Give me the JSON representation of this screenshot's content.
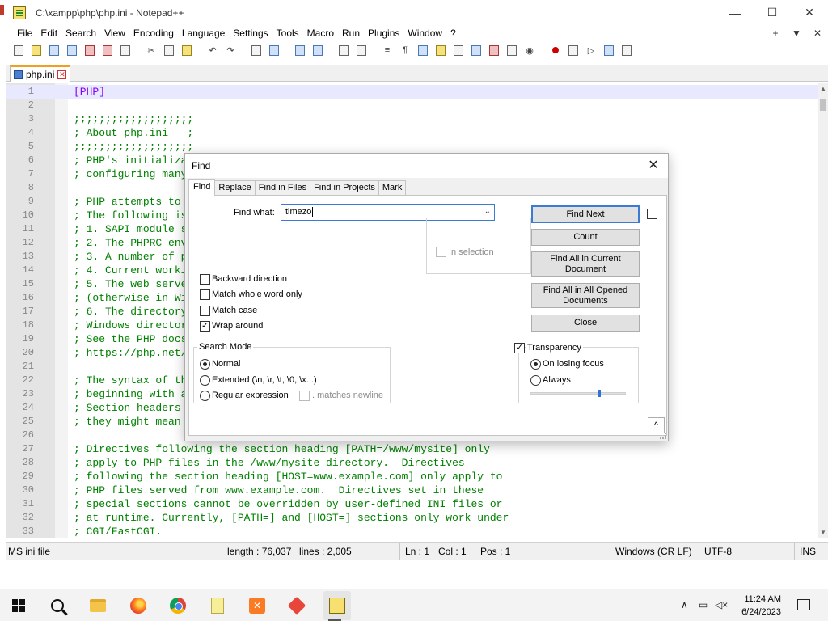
{
  "window": {
    "title": "C:\\xampp\\php\\php.ini - Notepad++",
    "minimize": "—",
    "maximize": "☐",
    "close": "✕"
  },
  "menu": {
    "items": [
      "File",
      "Edit",
      "Search",
      "View",
      "Encoding",
      "Language",
      "Settings",
      "Tools",
      "Macro",
      "Run",
      "Plugins",
      "Window",
      "?"
    ],
    "right": [
      "+",
      "▼",
      "✕"
    ]
  },
  "tab": {
    "label": "php.ini"
  },
  "editor": {
    "lines": [
      {
        "n": "1",
        "text": "[PHP]"
      },
      {
        "n": "2",
        "text": ""
      },
      {
        "n": "3",
        "text": ";;;;;;;;;;;;;;;;;;;"
      },
      {
        "n": "4",
        "text": "; About php.ini   ;"
      },
      {
        "n": "5",
        "text": ";;;;;;;;;;;;;;;;;;;"
      },
      {
        "n": "6",
        "text": "; PHP's initializa"
      },
      {
        "n": "7",
        "text": "; configuring many"
      },
      {
        "n": "8",
        "text": ""
      },
      {
        "n": "9",
        "text": "; PHP attempts to"
      },
      {
        "n": "10",
        "text": "; The following is"
      },
      {
        "n": "11",
        "text": "; 1. SAPI module s"
      },
      {
        "n": "12",
        "text": "; 2. The PHPRC env"
      },
      {
        "n": "13",
        "text": "; 3. A number of p"
      },
      {
        "n": "14",
        "text": "; 4. Current worki"
      },
      {
        "n": "15",
        "text": "; 5. The web serve"
      },
      {
        "n": "16",
        "text": "; (otherwise in Wi"
      },
      {
        "n": "17",
        "text": "; 6. The directory"
      },
      {
        "n": "18",
        "text": "; Windows director"
      },
      {
        "n": "19",
        "text": "; See the PHP docs"
      },
      {
        "n": "20",
        "text": "; https://php.net/"
      },
      {
        "n": "21",
        "text": ""
      },
      {
        "n": "22",
        "text": "; The syntax of th"
      },
      {
        "n": "23",
        "text": "; beginning with a"
      },
      {
        "n": "24",
        "text": "; Section headers"
      },
      {
        "n": "25",
        "text": "; they might mean"
      },
      {
        "n": "26",
        "text": ""
      },
      {
        "n": "27",
        "text": "; Directives following the section heading [PATH=/www/mysite] only"
      },
      {
        "n": "28",
        "text": "; apply to PHP files in the /www/mysite directory.  Directives"
      },
      {
        "n": "29",
        "text": "; following the section heading [HOST=www.example.com] only apply to"
      },
      {
        "n": "30",
        "text": "; PHP files served from www.example.com.  Directives set in these"
      },
      {
        "n": "31",
        "text": "; special sections cannot be overridden by user-defined INI files or"
      },
      {
        "n": "32",
        "text": "; at runtime. Currently, [PATH=] and [HOST=] sections only work under"
      },
      {
        "n": "33",
        "text": "; CGI/FastCGI."
      }
    ]
  },
  "status": {
    "type": "MS ini file",
    "length": "length : 76,037",
    "lines": "lines : 2,005",
    "ln": "Ln : 1",
    "col": "Col : 1",
    "pos": "Pos : 1",
    "eol": "Windows (CR LF)",
    "encoding": "UTF-8",
    "mode": "INS"
  },
  "find_dialog": {
    "title": "Find",
    "tabs": [
      "Find",
      "Replace",
      "Find in Files",
      "Find in Projects",
      "Mark"
    ],
    "find_what_label": "Find what:",
    "find_what_value": "timezo",
    "buttons": {
      "find_next": "Find Next",
      "count": "Count",
      "find_all_current": "Find All in Current Document",
      "find_all_opened": "Find All in All Opened Documents",
      "close": "Close"
    },
    "in_selection": "In selection",
    "options": {
      "backward": "Backward direction",
      "whole_word": "Match whole word only",
      "match_case": "Match case",
      "wrap_around": "Wrap around"
    },
    "search_mode": {
      "title": "Search Mode",
      "normal": "Normal",
      "extended": "Extended (\\n, \\r, \\t, \\0, \\x...)",
      "regex": "Regular expression",
      "matches_newline": ". matches newline",
      "selected": "normal"
    },
    "transparency": {
      "title": "Transparency",
      "on_losing_focus": "On losing focus",
      "always": "Always",
      "level_fraction": 0.72
    },
    "collapse": "^"
  },
  "taskbar": {
    "time": "11:24 AM",
    "date": "6/24/2023"
  }
}
